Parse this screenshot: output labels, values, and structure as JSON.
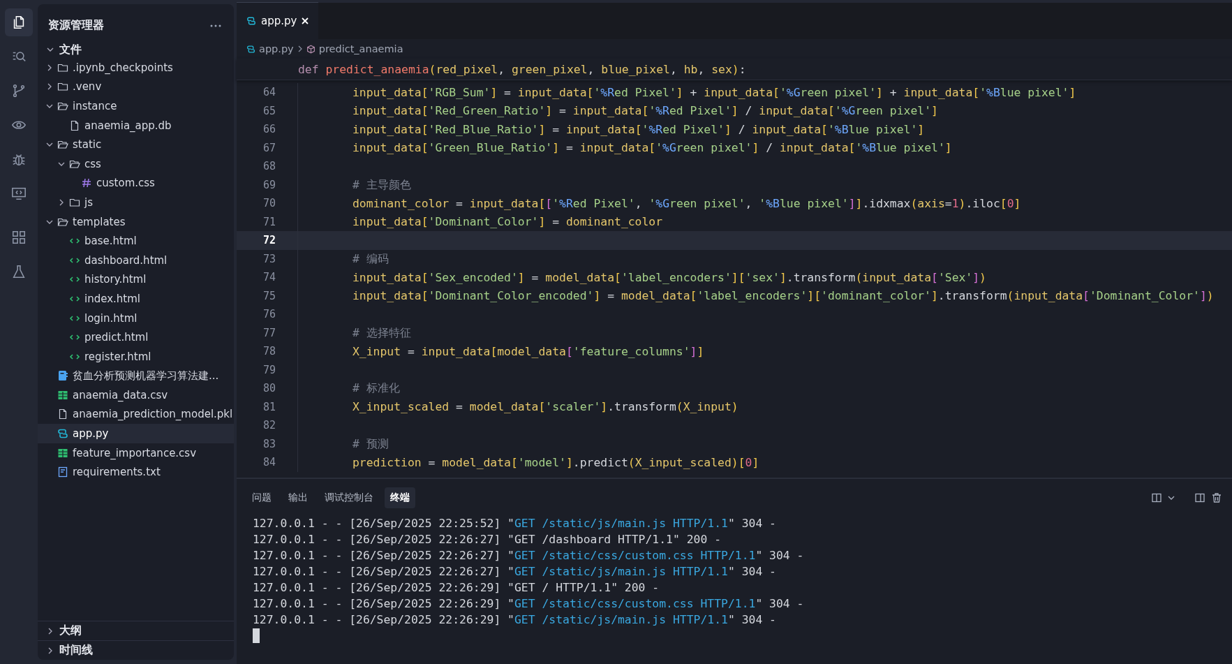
{
  "activity_bar": [
    {
      "kind": "files",
      "selected": true
    },
    {
      "kind": "search",
      "selected": false
    },
    {
      "kind": "git",
      "selected": false
    },
    {
      "kind": "preview",
      "selected": false
    },
    {
      "kind": "debug",
      "selected": false
    },
    {
      "kind": "remote",
      "selected": false
    },
    {
      "kind": "extensions",
      "selected": false
    },
    {
      "kind": "testing",
      "selected": false
    }
  ],
  "explorer": {
    "title": "资源管理器",
    "section": {
      "label": "文件",
      "expanded": true,
      "items": [
        {
          "label": ".ipynb_checkpoints",
          "kind": "folder",
          "expanded": false,
          "selected": false
        },
        {
          "label": ".venv",
          "kind": "folder",
          "expanded": false,
          "selected": false
        },
        {
          "label": "instance",
          "kind": "folder",
          "expanded": true,
          "selected": false,
          "children": [
            {
              "label": "anaemia_app.db",
              "kind": "file",
              "selected": false
            }
          ]
        },
        {
          "label": "static",
          "kind": "folder",
          "expanded": true,
          "selected": false,
          "children": [
            {
              "label": "css",
              "kind": "folder",
              "expanded": true,
              "selected": false,
              "children": [
                {
                  "label": "custom.css",
                  "kind": "css",
                  "selected": false
                }
              ]
            },
            {
              "label": "js",
              "kind": "folder",
              "expanded": false,
              "selected": false
            }
          ]
        },
        {
          "label": "templates",
          "kind": "folder",
          "expanded": true,
          "selected": false,
          "children": [
            {
              "label": "base.html",
              "kind": "html",
              "selected": false
            },
            {
              "label": "dashboard.html",
              "kind": "html",
              "selected": false
            },
            {
              "label": "history.html",
              "kind": "html",
              "selected": false
            },
            {
              "label": "index.html",
              "kind": "html",
              "selected": false
            },
            {
              "label": "login.html",
              "kind": "html",
              "selected": false
            },
            {
              "label": "predict.html",
              "kind": "html",
              "selected": false
            },
            {
              "label": "register.html",
              "kind": "html",
              "selected": false
            }
          ]
        },
        {
          "label": "贫血分析预测机器学习算法建...",
          "kind": "notebook",
          "selected": false
        },
        {
          "label": "anaemia_data.csv",
          "kind": "csv",
          "selected": false
        },
        {
          "label": "anaemia_prediction_model.pkl",
          "kind": "file",
          "selected": false
        },
        {
          "label": "app.py",
          "kind": "python",
          "selected": true
        },
        {
          "label": "feature_importance.csv",
          "kind": "csv",
          "selected": false
        },
        {
          "label": "requirements.txt",
          "kind": "text",
          "selected": false
        }
      ]
    },
    "bottom_sections": [
      {
        "label": "大纲",
        "expanded": false
      },
      {
        "label": "时间线",
        "expanded": false
      }
    ]
  },
  "editor": {
    "tabs": [
      {
        "label": "app.py",
        "kind": "python",
        "selected": true
      }
    ],
    "breadcrumb": [
      {
        "label": "app.py",
        "kind": "python"
      },
      {
        "label": "predict_anaemia",
        "kind": "symbol"
      }
    ],
    "sticky_line": [
      {
        "kind": "k",
        "text": "def "
      },
      {
        "kind": "f",
        "text": "predict_anaemia"
      },
      {
        "kind": "b1",
        "text": "("
      },
      {
        "kind": "v",
        "text": "red_pixel"
      },
      {
        "kind": "o",
        "text": ", "
      },
      {
        "kind": "v",
        "text": "green_pixel"
      },
      {
        "kind": "o",
        "text": ", "
      },
      {
        "kind": "v",
        "text": "blue_pixel"
      },
      {
        "kind": "o",
        "text": ", "
      },
      {
        "kind": "v",
        "text": "hb"
      },
      {
        "kind": "o",
        "text": ", "
      },
      {
        "kind": "v",
        "text": "sex"
      },
      {
        "kind": "b1",
        "text": ")"
      },
      {
        "kind": "o",
        "text": ":"
      }
    ],
    "lines": [
      {
        "number": "64",
        "current": false,
        "tokens": [
          {
            "kind": "v",
            "text": "input_data"
          },
          {
            "kind": "b1",
            "text": "["
          },
          {
            "kind": "s",
            "text": "'RGB_Sum'"
          },
          {
            "kind": "b1",
            "text": "]"
          },
          {
            "kind": "o",
            "text": " = "
          },
          {
            "kind": "v",
            "text": "input_data"
          },
          {
            "kind": "b1",
            "text": "["
          },
          {
            "kind": "s",
            "text": "'"
          },
          {
            "kind": "p",
            "text": "%R"
          },
          {
            "kind": "s",
            "text": "ed Pixel'"
          },
          {
            "kind": "b1",
            "text": "]"
          },
          {
            "kind": "o",
            "text": " + "
          },
          {
            "kind": "v",
            "text": "input_data"
          },
          {
            "kind": "b1",
            "text": "["
          },
          {
            "kind": "s",
            "text": "'"
          },
          {
            "kind": "p",
            "text": "%G"
          },
          {
            "kind": "s",
            "text": "reen pixel'"
          },
          {
            "kind": "b1",
            "text": "]"
          },
          {
            "kind": "o",
            "text": " + "
          },
          {
            "kind": "v",
            "text": "input_data"
          },
          {
            "kind": "b1",
            "text": "["
          },
          {
            "kind": "s",
            "text": "'"
          },
          {
            "kind": "p",
            "text": "%B"
          },
          {
            "kind": "s",
            "text": "lue pixel'"
          },
          {
            "kind": "b1",
            "text": "]"
          }
        ]
      },
      {
        "number": "65",
        "current": false,
        "tokens": [
          {
            "kind": "v",
            "text": "input_data"
          },
          {
            "kind": "b1",
            "text": "["
          },
          {
            "kind": "s",
            "text": "'Red_Green_Ratio'"
          },
          {
            "kind": "b1",
            "text": "]"
          },
          {
            "kind": "o",
            "text": " = "
          },
          {
            "kind": "v",
            "text": "input_data"
          },
          {
            "kind": "b1",
            "text": "["
          },
          {
            "kind": "s",
            "text": "'"
          },
          {
            "kind": "p",
            "text": "%R"
          },
          {
            "kind": "s",
            "text": "ed Pixel'"
          },
          {
            "kind": "b1",
            "text": "]"
          },
          {
            "kind": "o",
            "text": " / "
          },
          {
            "kind": "v",
            "text": "input_data"
          },
          {
            "kind": "b1",
            "text": "["
          },
          {
            "kind": "s",
            "text": "'"
          },
          {
            "kind": "p",
            "text": "%G"
          },
          {
            "kind": "s",
            "text": "reen pixel'"
          },
          {
            "kind": "b1",
            "text": "]"
          }
        ]
      },
      {
        "number": "66",
        "current": false,
        "tokens": [
          {
            "kind": "v",
            "text": "input_data"
          },
          {
            "kind": "b1",
            "text": "["
          },
          {
            "kind": "s",
            "text": "'Red_Blue_Ratio'"
          },
          {
            "kind": "b1",
            "text": "]"
          },
          {
            "kind": "o",
            "text": " = "
          },
          {
            "kind": "v",
            "text": "input_data"
          },
          {
            "kind": "b1",
            "text": "["
          },
          {
            "kind": "s",
            "text": "'"
          },
          {
            "kind": "p",
            "text": "%R"
          },
          {
            "kind": "s",
            "text": "ed Pixel'"
          },
          {
            "kind": "b1",
            "text": "]"
          },
          {
            "kind": "o",
            "text": " / "
          },
          {
            "kind": "v",
            "text": "input_data"
          },
          {
            "kind": "b1",
            "text": "["
          },
          {
            "kind": "s",
            "text": "'"
          },
          {
            "kind": "p",
            "text": "%B"
          },
          {
            "kind": "s",
            "text": "lue pixel'"
          },
          {
            "kind": "b1",
            "text": "]"
          }
        ]
      },
      {
        "number": "67",
        "current": false,
        "tokens": [
          {
            "kind": "v",
            "text": "input_data"
          },
          {
            "kind": "b1",
            "text": "["
          },
          {
            "kind": "s",
            "text": "'Green_Blue_Ratio'"
          },
          {
            "kind": "b1",
            "text": "]"
          },
          {
            "kind": "o",
            "text": " = "
          },
          {
            "kind": "v",
            "text": "input_data"
          },
          {
            "kind": "b1",
            "text": "["
          },
          {
            "kind": "s",
            "text": "'"
          },
          {
            "kind": "p",
            "text": "%G"
          },
          {
            "kind": "s",
            "text": "reen pixel'"
          },
          {
            "kind": "b1",
            "text": "]"
          },
          {
            "kind": "o",
            "text": " / "
          },
          {
            "kind": "v",
            "text": "input_data"
          },
          {
            "kind": "b1",
            "text": "["
          },
          {
            "kind": "s",
            "text": "'"
          },
          {
            "kind": "p",
            "text": "%B"
          },
          {
            "kind": "s",
            "text": "lue pixel'"
          },
          {
            "kind": "b1",
            "text": "]"
          }
        ]
      },
      {
        "number": "68",
        "current": false
      },
      {
        "number": "69",
        "current": false,
        "tokens": [
          {
            "kind": "c",
            "text": "# 主导颜色"
          }
        ]
      },
      {
        "number": "70",
        "current": false,
        "tokens": [
          {
            "kind": "v",
            "text": "dominant_color"
          },
          {
            "kind": "o",
            "text": " = "
          },
          {
            "kind": "v",
            "text": "input_data"
          },
          {
            "kind": "b1",
            "text": "["
          },
          {
            "kind": "b2",
            "text": "["
          },
          {
            "kind": "s",
            "text": "'"
          },
          {
            "kind": "p",
            "text": "%R"
          },
          {
            "kind": "s",
            "text": "ed Pixel'"
          },
          {
            "kind": "o",
            "text": ", "
          },
          {
            "kind": "s",
            "text": "'"
          },
          {
            "kind": "p",
            "text": "%G"
          },
          {
            "kind": "s",
            "text": "reen pixel'"
          },
          {
            "kind": "o",
            "text": ", "
          },
          {
            "kind": "s",
            "text": "'"
          },
          {
            "kind": "p",
            "text": "%B"
          },
          {
            "kind": "s",
            "text": "lue pixel'"
          },
          {
            "kind": "b2",
            "text": "]"
          },
          {
            "kind": "b1",
            "text": "]"
          },
          {
            "kind": "o",
            "text": ".idxmax"
          },
          {
            "kind": "b1",
            "text": "("
          },
          {
            "kind": "v",
            "text": "axis"
          },
          {
            "kind": "o",
            "text": "="
          },
          {
            "kind": "n",
            "text": "1"
          },
          {
            "kind": "b1",
            "text": ")"
          },
          {
            "kind": "o",
            "text": ".iloc"
          },
          {
            "kind": "b1",
            "text": "["
          },
          {
            "kind": "n",
            "text": "0"
          },
          {
            "kind": "b1",
            "text": "]"
          }
        ]
      },
      {
        "number": "71",
        "current": false,
        "tokens": [
          {
            "kind": "v",
            "text": "input_data"
          },
          {
            "kind": "b1",
            "text": "["
          },
          {
            "kind": "s",
            "text": "'Dominant_Color'"
          },
          {
            "kind": "b1",
            "text": "]"
          },
          {
            "kind": "o",
            "text": " = "
          },
          {
            "kind": "v",
            "text": "dominant_color"
          }
        ]
      },
      {
        "number": "72",
        "current": true
      },
      {
        "number": "73",
        "current": false,
        "tokens": [
          {
            "kind": "c",
            "text": "# 编码"
          }
        ]
      },
      {
        "number": "74",
        "current": false,
        "tokens": [
          {
            "kind": "v",
            "text": "input_data"
          },
          {
            "kind": "b1",
            "text": "["
          },
          {
            "kind": "s",
            "text": "'Sex_encoded'"
          },
          {
            "kind": "b1",
            "text": "]"
          },
          {
            "kind": "o",
            "text": " = "
          },
          {
            "kind": "v",
            "text": "model_data"
          },
          {
            "kind": "b1",
            "text": "["
          },
          {
            "kind": "s",
            "text": "'label_encoders'"
          },
          {
            "kind": "b1",
            "text": "]"
          },
          {
            "kind": "b1",
            "text": "["
          },
          {
            "kind": "s",
            "text": "'sex'"
          },
          {
            "kind": "b1",
            "text": "]"
          },
          {
            "kind": "o",
            "text": ".transform"
          },
          {
            "kind": "b1",
            "text": "("
          },
          {
            "kind": "v",
            "text": "input_data"
          },
          {
            "kind": "b2",
            "text": "["
          },
          {
            "kind": "s",
            "text": "'Sex'"
          },
          {
            "kind": "b2",
            "text": "]"
          },
          {
            "kind": "b1",
            "text": ")"
          }
        ]
      },
      {
        "number": "75",
        "current": false,
        "tokens": [
          {
            "kind": "v",
            "text": "input_data"
          },
          {
            "kind": "b1",
            "text": "["
          },
          {
            "kind": "s",
            "text": "'Dominant_Color_encoded'"
          },
          {
            "kind": "b1",
            "text": "]"
          },
          {
            "kind": "o",
            "text": " = "
          },
          {
            "kind": "v",
            "text": "model_data"
          },
          {
            "kind": "b1",
            "text": "["
          },
          {
            "kind": "s",
            "text": "'label_encoders'"
          },
          {
            "kind": "b1",
            "text": "]"
          },
          {
            "kind": "b1",
            "text": "["
          },
          {
            "kind": "s",
            "text": "'dominant_color'"
          },
          {
            "kind": "b1",
            "text": "]"
          },
          {
            "kind": "o",
            "text": ".transform"
          },
          {
            "kind": "b1",
            "text": "("
          },
          {
            "kind": "v",
            "text": "input_data"
          },
          {
            "kind": "b2",
            "text": "["
          },
          {
            "kind": "s",
            "text": "'Dominant_Color'"
          },
          {
            "kind": "b2",
            "text": "]"
          },
          {
            "kind": "b1",
            "text": ")"
          }
        ]
      },
      {
        "number": "76",
        "current": false
      },
      {
        "number": "77",
        "current": false,
        "tokens": [
          {
            "kind": "c",
            "text": "# 选择特征"
          }
        ]
      },
      {
        "number": "78",
        "current": false,
        "tokens": [
          {
            "kind": "v",
            "text": "X_input"
          },
          {
            "kind": "o",
            "text": " = "
          },
          {
            "kind": "v",
            "text": "input_data"
          },
          {
            "kind": "b1",
            "text": "["
          },
          {
            "kind": "v",
            "text": "model_data"
          },
          {
            "kind": "b2",
            "text": "["
          },
          {
            "kind": "s",
            "text": "'feature_columns'"
          },
          {
            "kind": "b2",
            "text": "]"
          },
          {
            "kind": "b1",
            "text": "]"
          }
        ]
      },
      {
        "number": "79",
        "current": false
      },
      {
        "number": "80",
        "current": false,
        "tokens": [
          {
            "kind": "c",
            "text": "# 标准化"
          }
        ]
      },
      {
        "number": "81",
        "current": false,
        "tokens": [
          {
            "kind": "v",
            "text": "X_input_scaled"
          },
          {
            "kind": "o",
            "text": " = "
          },
          {
            "kind": "v",
            "text": "model_data"
          },
          {
            "kind": "b1",
            "text": "["
          },
          {
            "kind": "s",
            "text": "'scaler'"
          },
          {
            "kind": "b1",
            "text": "]"
          },
          {
            "kind": "o",
            "text": ".transform"
          },
          {
            "kind": "b1",
            "text": "("
          },
          {
            "kind": "v",
            "text": "X_input"
          },
          {
            "kind": "b1",
            "text": ")"
          }
        ]
      },
      {
        "number": "82",
        "current": false
      },
      {
        "number": "83",
        "current": false,
        "tokens": [
          {
            "kind": "c",
            "text": "# 预测"
          }
        ]
      },
      {
        "number": "84",
        "current": false,
        "tokens": [
          {
            "kind": "v",
            "text": "prediction"
          },
          {
            "kind": "o",
            "text": " = "
          },
          {
            "kind": "v",
            "text": "model_data"
          },
          {
            "kind": "b1",
            "text": "["
          },
          {
            "kind": "s",
            "text": "'model'"
          },
          {
            "kind": "b1",
            "text": "]"
          },
          {
            "kind": "o",
            "text": ".predict"
          },
          {
            "kind": "b1",
            "text": "("
          },
          {
            "kind": "v",
            "text": "X_input_scaled"
          },
          {
            "kind": "b1",
            "text": ")"
          },
          {
            "kind": "b1",
            "text": "["
          },
          {
            "kind": "n",
            "text": "0"
          },
          {
            "kind": "b1",
            "text": "]"
          }
        ]
      }
    ]
  },
  "panel": {
    "tabs": [
      {
        "label": "问题",
        "selected": false
      },
      {
        "label": "输出",
        "selected": false
      },
      {
        "label": "调试控制台",
        "selected": false
      },
      {
        "label": "终端",
        "selected": true
      }
    ],
    "terminal_lines": [
      [
        {
          "kind": "t",
          "text": "127.0.0.1 - - [26/Sep/2025 22:25:52] \""
        },
        {
          "kind": "u",
          "text": "GET /static/js/main.js HTTP/1.1"
        },
        {
          "kind": "t",
          "text": "\" 304 -"
        }
      ],
      [
        {
          "kind": "t",
          "text": "127.0.0.1 - - [26/Sep/2025 22:26:27] \"GET /dashboard HTTP/1.1\" 200 -"
        }
      ],
      [
        {
          "kind": "t",
          "text": "127.0.0.1 - - [26/Sep/2025 22:26:27] \""
        },
        {
          "kind": "u",
          "text": "GET /static/css/custom.css HTTP/1.1"
        },
        {
          "kind": "t",
          "text": "\" 304 -"
        }
      ],
      [
        {
          "kind": "t",
          "text": "127.0.0.1 - - [26/Sep/2025 22:26:27] \""
        },
        {
          "kind": "u",
          "text": "GET /static/js/main.js HTTP/1.1"
        },
        {
          "kind": "t",
          "text": "\" 304 -"
        }
      ],
      [
        {
          "kind": "t",
          "text": "127.0.0.1 - - [26/Sep/2025 22:26:29] \"GET / HTTP/1.1\" 200 -"
        }
      ],
      [
        {
          "kind": "t",
          "text": "127.0.0.1 - - [26/Sep/2025 22:26:29] \""
        },
        {
          "kind": "u",
          "text": "GET /static/css/custom.css HTTP/1.1"
        },
        {
          "kind": "t",
          "text": "\" 304 -"
        }
      ],
      [
        {
          "kind": "t",
          "text": "127.0.0.1 - - [26/Sep/2025 22:26:29] \""
        },
        {
          "kind": "u",
          "text": "GET /static/js/main.js HTTP/1.1"
        },
        {
          "kind": "t",
          "text": "\" 304 -"
        }
      ]
    ]
  }
}
